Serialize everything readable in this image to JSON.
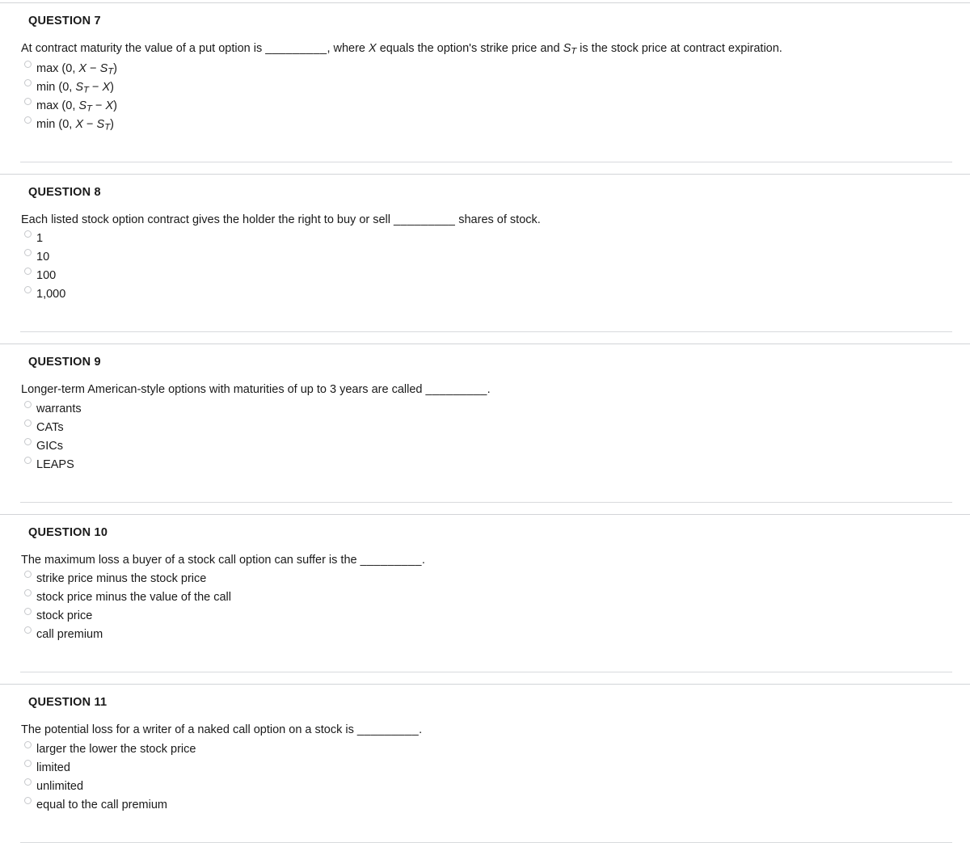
{
  "document": {
    "type": "quiz",
    "colors": {
      "background": "#ffffff",
      "text": "#1a1a1a",
      "rule_full": "#d2d4d7",
      "rule_inset": "#d8dadd",
      "radio_border": "#c6c8cb"
    }
  },
  "questions": [
    {
      "header": "QUESTION 7",
      "stem_parts": [
        {
          "text": "At contract maturity the value of a put option is "
        },
        {
          "text": "_________",
          "style": "blank"
        },
        {
          "text": ", where "
        },
        {
          "text": "X",
          "style": "italic"
        },
        {
          "text": " equals the option's strike price and "
        },
        {
          "text": "S",
          "style": "italic",
          "sub": "T"
        },
        {
          "text": " is the stock price at contract expiration."
        }
      ],
      "stem_plain": "At contract maturity the value of a put option is _________, where X equals the option's strike price and S_T is the stock price at contract expiration.",
      "options": [
        {
          "label": "max (0, X − S_T)",
          "math": true,
          "parts": [
            {
              "text": "max (0, "
            },
            {
              "text": "X",
              "style": "italic"
            },
            {
              "text": " − "
            },
            {
              "text": "S",
              "style": "italic",
              "sub": "T"
            },
            {
              "text": ")"
            }
          ]
        },
        {
          "label": "min (0, S_T − X)",
          "math": true,
          "parts": [
            {
              "text": "min (0, "
            },
            {
              "text": "S",
              "style": "italic",
              "sub": "T"
            },
            {
              "text": " − "
            },
            {
              "text": "X",
              "style": "italic"
            },
            {
              "text": ")"
            }
          ]
        },
        {
          "label": "max (0, S_T − X)",
          "math": true,
          "parts": [
            {
              "text": "max (0, "
            },
            {
              "text": "S",
              "style": "italic",
              "sub": "T"
            },
            {
              "text": " − "
            },
            {
              "text": "X",
              "style": "italic"
            },
            {
              "text": ")"
            }
          ]
        },
        {
          "label": "min (0, X − S_T)",
          "math": true,
          "parts": [
            {
              "text": "min (0, "
            },
            {
              "text": "X",
              "style": "italic"
            },
            {
              "text": " − "
            },
            {
              "text": "S",
              "style": "italic",
              "sub": "T"
            },
            {
              "text": ")"
            }
          ]
        }
      ]
    },
    {
      "header": "QUESTION 8",
      "stem_parts": [
        {
          "text": "Each listed stock option contract gives the holder the right to buy or sell "
        },
        {
          "text": "_________",
          "style": "blank"
        },
        {
          "text": " shares of stock."
        }
      ],
      "stem_plain": "Each listed stock option contract gives the holder the right to buy or sell _________ shares of stock.",
      "options": [
        {
          "label": "1"
        },
        {
          "label": "10"
        },
        {
          "label": "100"
        },
        {
          "label": "1,000"
        }
      ]
    },
    {
      "header": "QUESTION 9",
      "stem_parts": [
        {
          "text": "Longer-term American-style options with maturities of up to 3 years are called "
        },
        {
          "text": "_________",
          "style": "blank"
        },
        {
          "text": "."
        }
      ],
      "stem_plain": "Longer-term American-style options with maturities of up to 3 years are called _________.",
      "options": [
        {
          "label": "warrants"
        },
        {
          "label": "CATs"
        },
        {
          "label": "GICs"
        },
        {
          "label": "LEAPS"
        }
      ]
    },
    {
      "header": "QUESTION 10",
      "stem_parts": [
        {
          "text": "The maximum loss a buyer of a stock call option can suffer is the "
        },
        {
          "text": "_________",
          "style": "blank"
        },
        {
          "text": "."
        }
      ],
      "stem_plain": "The maximum loss a buyer of a stock call option can suffer is the _________.",
      "options": [
        {
          "label": "strike price minus the stock price"
        },
        {
          "label": "stock price minus the value of the call"
        },
        {
          "label": "stock price"
        },
        {
          "label": "call premium"
        }
      ]
    },
    {
      "header": "QUESTION 11",
      "stem_parts": [
        {
          "text": "The potential loss for a writer of a naked call option on a stock is "
        },
        {
          "text": "_________",
          "style": "blank"
        },
        {
          "text": "."
        }
      ],
      "stem_plain": "The potential loss for a writer of a naked call option on a stock is _________.",
      "options": [
        {
          "label": "larger the lower the stock price"
        },
        {
          "label": "limited"
        },
        {
          "label": "unlimited"
        },
        {
          "label": "equal to the call premium"
        }
      ]
    }
  ]
}
